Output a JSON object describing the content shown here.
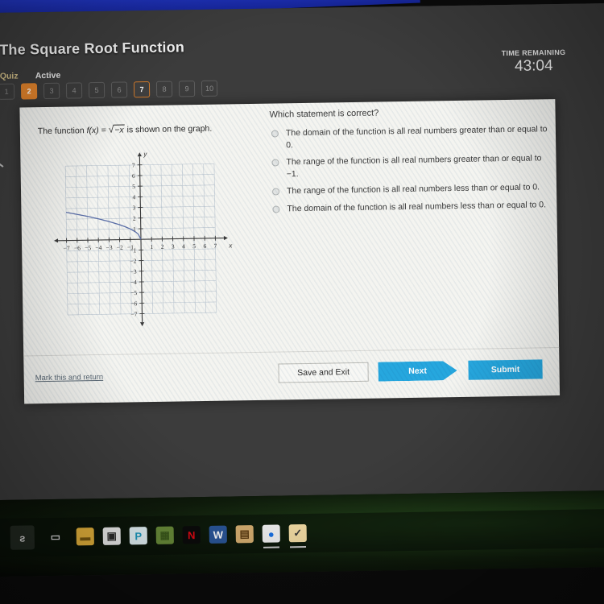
{
  "header": {
    "title": "The Square Root Function",
    "quiz_label": "Quiz",
    "status_label": "Active",
    "question_numbers": [
      "1",
      "2",
      "3",
      "4",
      "5",
      "6",
      "7",
      "8",
      "9",
      "10"
    ],
    "current_question": "2",
    "marked_question": "7",
    "timer_label": "TIME REMAINING",
    "timer_value": "43:04",
    "accent_color": "#e3842c"
  },
  "question": {
    "stem_prefix": "The function ",
    "stem_fn": "f(x)",
    "stem_eq": " = ",
    "stem_radicand": "−x",
    "stem_suffix": " is shown on the graph.",
    "prompt": "Which statement is correct?",
    "options": [
      "The domain of the function is all real numbers greater than or equal to 0.",
      "The range of the function is all real numbers greater than or equal to −1.",
      "The range of the function is all real numbers less than or equal to 0.",
      "The domain of the function is all real numbers less than or equal to 0."
    ],
    "selected_option": null
  },
  "chart_data": {
    "type": "line",
    "title": "",
    "xlabel": "x",
    "ylabel": "y",
    "xlim": [
      -7.5,
      7.5
    ],
    "ylim": [
      -7.5,
      7.5
    ],
    "xticks": [
      -7,
      -6,
      -5,
      -4,
      -3,
      -2,
      -1,
      1,
      2,
      3,
      4,
      5,
      6,
      7
    ],
    "yticks": [
      -7,
      -6,
      -5,
      -4,
      -3,
      -2,
      -1,
      1,
      2,
      3,
      4,
      5,
      6,
      7
    ],
    "grid": true,
    "series": [
      {
        "name": "f(x) = sqrt(-x)",
        "color": "#5a6ea8",
        "x": [
          0,
          -0.25,
          -0.5,
          -1,
          -1.5,
          -2,
          -3,
          -4,
          -5,
          -6,
          -7
        ],
        "y": [
          0,
          0.5,
          0.71,
          1,
          1.22,
          1.41,
          1.73,
          2,
          2.24,
          2.45,
          2.65
        ]
      }
    ]
  },
  "footer": {
    "mark_link": "Mark this and return",
    "save_label": "Save and Exit",
    "next_label": "Next",
    "submit_label": "Submit",
    "button_color": "#26a7de"
  },
  "taskbar": {
    "icons": [
      {
        "name": "microphone-icon",
        "glyph": "ƨ",
        "bg": "transparent",
        "fg": "#d8d8d8",
        "highlight": true,
        "active": false
      },
      {
        "name": "task-view-icon",
        "glyph": "▭",
        "bg": "transparent",
        "fg": "#e0e0e0",
        "highlight": false,
        "active": false
      },
      {
        "name": "file-explorer-icon",
        "glyph": "▬",
        "bg": "#e8b53c",
        "fg": "#7a5a10",
        "highlight": false,
        "active": false
      },
      {
        "name": "microsoft-store-icon",
        "glyph": "▣",
        "bg": "#f2f2f2",
        "fg": "#2b2b2b",
        "highlight": false,
        "active": false
      },
      {
        "name": "paint-app-icon",
        "glyph": "P",
        "bg": "#e8f7fb",
        "fg": "#1f9ec4",
        "highlight": false,
        "active": false
      },
      {
        "name": "minecraft-icon",
        "glyph": "▦",
        "bg": "#6a8d3a",
        "fg": "#3c5a1c",
        "highlight": false,
        "active": false
      },
      {
        "name": "netflix-icon",
        "glyph": "N",
        "bg": "#0b0b0b",
        "fg": "#e50914",
        "highlight": false,
        "active": false
      },
      {
        "name": "word-icon",
        "glyph": "W",
        "bg": "#2b579a",
        "fg": "#ffffff",
        "highlight": false,
        "active": false
      },
      {
        "name": "notes-app-icon",
        "glyph": "▤",
        "bg": "#d8b072",
        "fg": "#5a3a10",
        "highlight": false,
        "active": false
      },
      {
        "name": "chrome-icon",
        "glyph": "●",
        "bg": "#f5f5f5",
        "fg": "#1a73e8",
        "highlight": false,
        "active": true
      },
      {
        "name": "checkmark-app-icon",
        "glyph": "✓",
        "bg": "#f6dfa6",
        "fg": "#3a3a3a",
        "highlight": false,
        "active": true
      }
    ]
  }
}
